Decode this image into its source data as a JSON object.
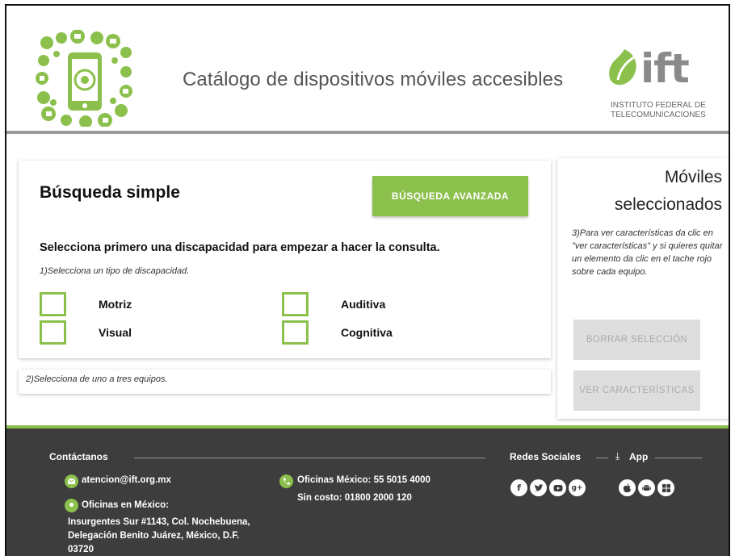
{
  "header": {
    "title": "Catálogo de dispositivos móviles accesibles",
    "logo_word": "ift",
    "logo_sub_line1": "INSTITUTO FEDERAL DE",
    "logo_sub_line2": "TELECOMUNICACIONES"
  },
  "search": {
    "title": "Búsqueda simple",
    "advanced_button": "BÚSQUEDA AVANZADA",
    "instruction": "Selecciona primero una discapacidad para empezar a hacer la consulta.",
    "step1": "1)Selecciona un tipo de discapacidad.",
    "options": [
      "Motriz",
      "Auditiva",
      "Visual",
      "Cognitiva"
    ],
    "step2": "2)Selecciona de uno a tres equipos."
  },
  "selected": {
    "title_line1": "Móviles",
    "title_line2": "seleccionados",
    "step3": "3)Para ver características da clic en \"ver características\" y si quieres quitar un elemento da clic en el tache rojo sobre cada equipo.",
    "clear_button": "BORRAR SELECCIÓN",
    "view_button": "VER CARACTERÍSTICAS"
  },
  "footer": {
    "contact_heading": "Contáctanos",
    "email": "atencion@ift.org.mx",
    "offices_label": "Oficinas en México:",
    "address_line1": "Insurgentes Sur #1143, Col. Nochebuena,",
    "address_line2": "Delegación Benito Juárez, México, D.F.",
    "address_line3": "03720",
    "phone": "Oficinas México: 55 5015 4000",
    "toll_free": "Sin costo: 01800 2000 120",
    "social_heading": "Redes Sociales",
    "app_heading": "App",
    "social_icons": [
      "facebook-icon",
      "twitter-icon",
      "youtube-icon",
      "google-plus-icon"
    ],
    "app_icons": [
      "apple-icon",
      "android-icon",
      "windows-icon"
    ]
  },
  "colors": {
    "accent": "#8cc04c",
    "footer_bg": "#3d3d3d",
    "header_rule": "#9b9b9b",
    "disabled_button": "#dedede"
  }
}
